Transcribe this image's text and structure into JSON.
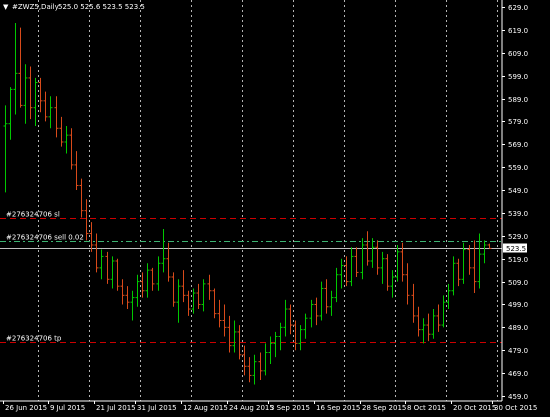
{
  "header": {
    "symbol_label": "#ZWZ5,Daily",
    "ohlc_label": "525.0 525.6 523.5 523.5",
    "dropdown_glyph": "▼"
  },
  "colors": {
    "background": "#000000",
    "bull": "#00c800",
    "bear": "#d84a1a",
    "grid": "#ffffff",
    "order_line": "#cc0000",
    "sell_line": "#3cb371",
    "price_line": "#bfbfbf",
    "text": "#ffffff"
  },
  "orders": [
    {
      "id": "sl",
      "label": "#276324706 sl",
      "price": 536.8,
      "color": "#cc0000"
    },
    {
      "id": "sell",
      "label": "#276324706 sell 0.02",
      "price": 526.8,
      "color": "#3cb371"
    },
    {
      "id": "tp",
      "label": "#276324706 tp",
      "price": 482.8,
      "color": "#cc0000"
    }
  ],
  "current_price": {
    "value": 523.5,
    "label": "523.5"
  },
  "chart_data": {
    "type": "ohlc",
    "title": "#ZWZ5,Daily",
    "ylim": [
      457.5,
      631.0
    ],
    "y_ticks": [
      629.0,
      619.0,
      609.0,
      599.0,
      589.0,
      579.0,
      569.0,
      559.0,
      549.0,
      539.0,
      529.0,
      519.0,
      509.0,
      499.0,
      489.0,
      479.0,
      469.0,
      459.0
    ],
    "x_labels": [
      "26 Jun 2015",
      "9 Jul 2015",
      "21 Jul 2015",
      "31 Jul 2015",
      "12 Aug 2015",
      "24 Aug 2015",
      "3 Sep 2015",
      "16 Sep 2015",
      "28 Sep 2015",
      "8 Oct 2015",
      "20 Oct 2015",
      "30 Oct 2015"
    ],
    "x_label_bar_index": [
      0,
      9,
      18,
      26,
      35,
      44,
      52,
      61,
      70,
      79,
      88,
      96
    ],
    "week_separator_bar_index": [
      7,
      17,
      27,
      37,
      47,
      57,
      67,
      77,
      87,
      97
    ],
    "bars": [
      {
        "o": 577,
        "h": 586,
        "l": 548,
        "c": 578
      },
      {
        "o": 578,
        "h": 594,
        "l": 571,
        "c": 593
      },
      {
        "o": 593,
        "h": 622,
        "l": 582,
        "c": 600
      },
      {
        "o": 600,
        "h": 620,
        "l": 585,
        "c": 586
      },
      {
        "o": 586,
        "h": 604,
        "l": 578,
        "c": 598
      },
      {
        "o": 598,
        "h": 603,
        "l": 580,
        "c": 585
      },
      {
        "o": 585,
        "h": 598,
        "l": 577,
        "c": 596
      },
      {
        "o": 596,
        "h": 598,
        "l": 583,
        "c": 588
      },
      {
        "o": 588,
        "h": 592,
        "l": 579,
        "c": 581
      },
      {
        "o": 581,
        "h": 590,
        "l": 576,
        "c": 585
      },
      {
        "o": 585,
        "h": 590,
        "l": 572,
        "c": 576
      },
      {
        "o": 576,
        "h": 581,
        "l": 568,
        "c": 570
      },
      {
        "o": 570,
        "h": 577,
        "l": 565,
        "c": 573
      },
      {
        "o": 573,
        "h": 576,
        "l": 558,
        "c": 560
      },
      {
        "o": 560,
        "h": 566,
        "l": 549,
        "c": 551
      },
      {
        "o": 551,
        "h": 554,
        "l": 537,
        "c": 540
      },
      {
        "o": 540,
        "h": 545,
        "l": 527,
        "c": 530
      },
      {
        "o": 530,
        "h": 535,
        "l": 522,
        "c": 525
      },
      {
        "o": 525,
        "h": 530,
        "l": 513,
        "c": 515
      },
      {
        "o": 515,
        "h": 523,
        "l": 510,
        "c": 520
      },
      {
        "o": 520,
        "h": 522,
        "l": 508,
        "c": 510
      },
      {
        "o": 510,
        "h": 520,
        "l": 506,
        "c": 518
      },
      {
        "o": 518,
        "h": 519,
        "l": 505,
        "c": 507
      },
      {
        "o": 507,
        "h": 510,
        "l": 499,
        "c": 503
      },
      {
        "o": 503,
        "h": 507,
        "l": 497,
        "c": 500
      },
      {
        "o": 500,
        "h": 505,
        "l": 492,
        "c": 502
      },
      {
        "o": 502,
        "h": 512,
        "l": 498,
        "c": 509
      },
      {
        "o": 509,
        "h": 513,
        "l": 502,
        "c": 505
      },
      {
        "o": 505,
        "h": 517,
        "l": 502,
        "c": 514
      },
      {
        "o": 514,
        "h": 515,
        "l": 505,
        "c": 508
      },
      {
        "o": 508,
        "h": 520,
        "l": 505,
        "c": 517
      },
      {
        "o": 517,
        "h": 532,
        "l": 513,
        "c": 519
      },
      {
        "o": 519,
        "h": 526,
        "l": 509,
        "c": 511
      },
      {
        "o": 511,
        "h": 513,
        "l": 498,
        "c": 500
      },
      {
        "o": 500,
        "h": 510,
        "l": 491,
        "c": 507
      },
      {
        "o": 507,
        "h": 514,
        "l": 500,
        "c": 503
      },
      {
        "o": 503,
        "h": 505,
        "l": 494,
        "c": 497
      },
      {
        "o": 497,
        "h": 506,
        "l": 495,
        "c": 504
      },
      {
        "o": 504,
        "h": 508,
        "l": 497,
        "c": 499
      },
      {
        "o": 499,
        "h": 510,
        "l": 496,
        "c": 508
      },
      {
        "o": 508,
        "h": 512,
        "l": 501,
        "c": 505
      },
      {
        "o": 505,
        "h": 506,
        "l": 493,
        "c": 495
      },
      {
        "o": 495,
        "h": 501,
        "l": 489,
        "c": 492
      },
      {
        "o": 492,
        "h": 499,
        "l": 485,
        "c": 489
      },
      {
        "o": 489,
        "h": 494,
        "l": 478,
        "c": 481
      },
      {
        "o": 481,
        "h": 492,
        "l": 478,
        "c": 487
      },
      {
        "o": 487,
        "h": 490,
        "l": 475,
        "c": 477
      },
      {
        "o": 477,
        "h": 481,
        "l": 468,
        "c": 472
      },
      {
        "o": 472,
        "h": 476,
        "l": 465,
        "c": 468
      },
      {
        "o": 468,
        "h": 477,
        "l": 464,
        "c": 474
      },
      {
        "o": 474,
        "h": 478,
        "l": 466,
        "c": 470
      },
      {
        "o": 470,
        "h": 482,
        "l": 468,
        "c": 478
      },
      {
        "o": 478,
        "h": 485,
        "l": 473,
        "c": 482
      },
      {
        "o": 482,
        "h": 487,
        "l": 476,
        "c": 485
      },
      {
        "o": 485,
        "h": 491,
        "l": 479,
        "c": 489
      },
      {
        "o": 489,
        "h": 501,
        "l": 485,
        "c": 497
      },
      {
        "o": 497,
        "h": 499,
        "l": 486,
        "c": 490
      },
      {
        "o": 490,
        "h": 492,
        "l": 479,
        "c": 482
      },
      {
        "o": 482,
        "h": 490,
        "l": 479,
        "c": 488
      },
      {
        "o": 488,
        "h": 495,
        "l": 484,
        "c": 493
      },
      {
        "o": 493,
        "h": 501,
        "l": 489,
        "c": 499
      },
      {
        "o": 499,
        "h": 502,
        "l": 490,
        "c": 494
      },
      {
        "o": 494,
        "h": 509,
        "l": 492,
        "c": 506
      },
      {
        "o": 506,
        "h": 510,
        "l": 495,
        "c": 498
      },
      {
        "o": 498,
        "h": 505,
        "l": 494,
        "c": 502
      },
      {
        "o": 502,
        "h": 515,
        "l": 500,
        "c": 512
      },
      {
        "o": 512,
        "h": 519,
        "l": 506,
        "c": 516
      },
      {
        "o": 516,
        "h": 520,
        "l": 507,
        "c": 509
      },
      {
        "o": 509,
        "h": 524,
        "l": 507,
        "c": 520
      },
      {
        "o": 520,
        "h": 524,
        "l": 511,
        "c": 513
      },
      {
        "o": 513,
        "h": 528,
        "l": 510,
        "c": 525
      },
      {
        "o": 525,
        "h": 531,
        "l": 516,
        "c": 518
      },
      {
        "o": 518,
        "h": 528,
        "l": 515,
        "c": 524
      },
      {
        "o": 524,
        "h": 527,
        "l": 512,
        "c": 515
      },
      {
        "o": 515,
        "h": 522,
        "l": 508,
        "c": 519
      },
      {
        "o": 519,
        "h": 521,
        "l": 505,
        "c": 507
      },
      {
        "o": 507,
        "h": 514,
        "l": 502,
        "c": 511
      },
      {
        "o": 511,
        "h": 525,
        "l": 509,
        "c": 522
      },
      {
        "o": 522,
        "h": 526,
        "l": 509,
        "c": 512
      },
      {
        "o": 512,
        "h": 517,
        "l": 499,
        "c": 503
      },
      {
        "o": 503,
        "h": 508,
        "l": 491,
        "c": 494
      },
      {
        "o": 494,
        "h": 498,
        "l": 485,
        "c": 488
      },
      {
        "o": 488,
        "h": 493,
        "l": 482,
        "c": 490
      },
      {
        "o": 490,
        "h": 495,
        "l": 483,
        "c": 486
      },
      {
        "o": 486,
        "h": 497,
        "l": 484,
        "c": 494
      },
      {
        "o": 494,
        "h": 499,
        "l": 487,
        "c": 490
      },
      {
        "o": 490,
        "h": 503,
        "l": 489,
        "c": 500
      },
      {
        "o": 500,
        "h": 508,
        "l": 497,
        "c": 505
      },
      {
        "o": 505,
        "h": 520,
        "l": 503,
        "c": 517
      },
      {
        "o": 517,
        "h": 519,
        "l": 507,
        "c": 510
      },
      {
        "o": 510,
        "h": 526,
        "l": 508,
        "c": 523
      },
      {
        "o": 523,
        "h": 525,
        "l": 512,
        "c": 515
      },
      {
        "o": 515,
        "h": 527,
        "l": 504,
        "c": 509
      },
      {
        "o": 509,
        "h": 530,
        "l": 506,
        "c": 521
      },
      {
        "o": 521,
        "h": 527,
        "l": 517,
        "c": 525
      },
      {
        "o": 525,
        "h": 525.6,
        "l": 523.5,
        "c": 523.5
      }
    ]
  }
}
